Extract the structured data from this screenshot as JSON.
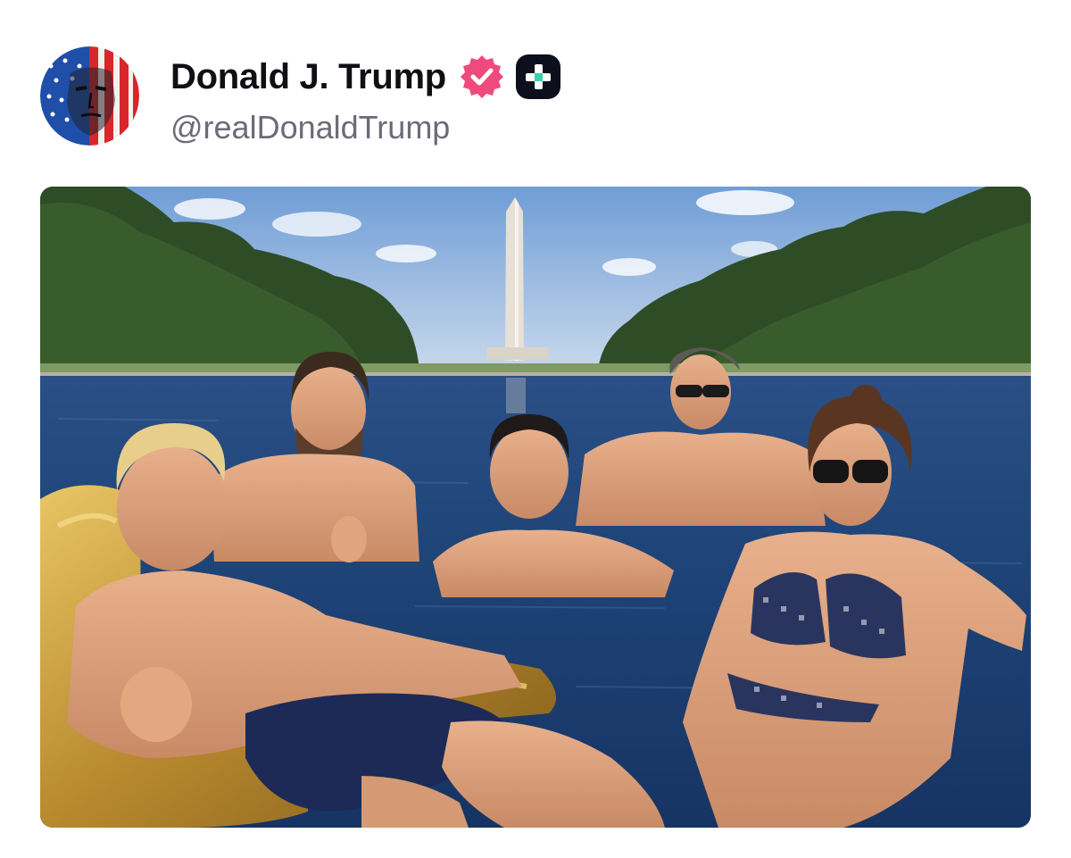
{
  "post": {
    "author": {
      "display_name": "Donald J. Trump",
      "handle": "@realDonaldTrump",
      "avatar_icon": "flag-portrait-avatar",
      "verified_icon": "verified-badge-icon",
      "verified_color": "#ee4a7e",
      "plus_icon": "plus-badge-icon",
      "plus_badge_color": "#0d0f1c"
    },
    "media": {
      "kind": "photo",
      "subject": "reflecting-pool-photo"
    }
  },
  "colors": {
    "name_text": "#0f0f14",
    "handle_text": "#6b6b78",
    "background": "#ffffff"
  }
}
